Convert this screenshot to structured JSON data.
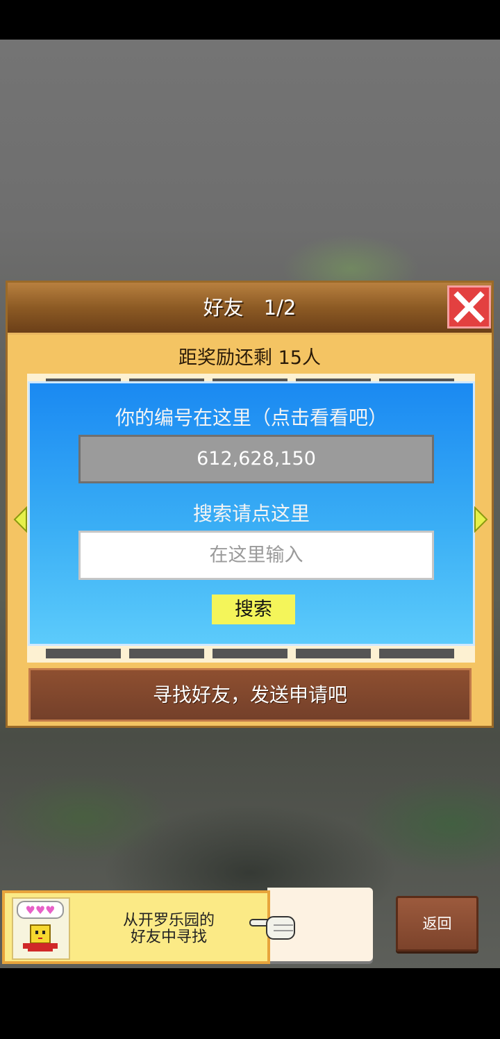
{
  "dialog": {
    "title": "好友　1/2",
    "reward_text": "距奖励还剩 15人",
    "id_label": "你的编号在这里（点击看看吧）",
    "player_id": "612,628,150",
    "search_label": "搜索请点这里",
    "search_placeholder": "在这里输入",
    "search_button": "搜索",
    "find_button": "寻找好友，发送申请吧"
  },
  "bottom": {
    "notice_line1": "从开罗乐园的",
    "notice_line2": "好友中寻找",
    "back_button": "返回"
  },
  "colors": {
    "panel_blue": "#1a89f2",
    "dialog_gold": "#f4c463",
    "close_red": "#e34040",
    "search_button_yellow": "#f4f55a"
  },
  "icons": [
    "close-icon",
    "left-arrow-icon",
    "right-arrow-icon",
    "pointing-hand-icon",
    "hearts-icon",
    "robot-avatar"
  ]
}
